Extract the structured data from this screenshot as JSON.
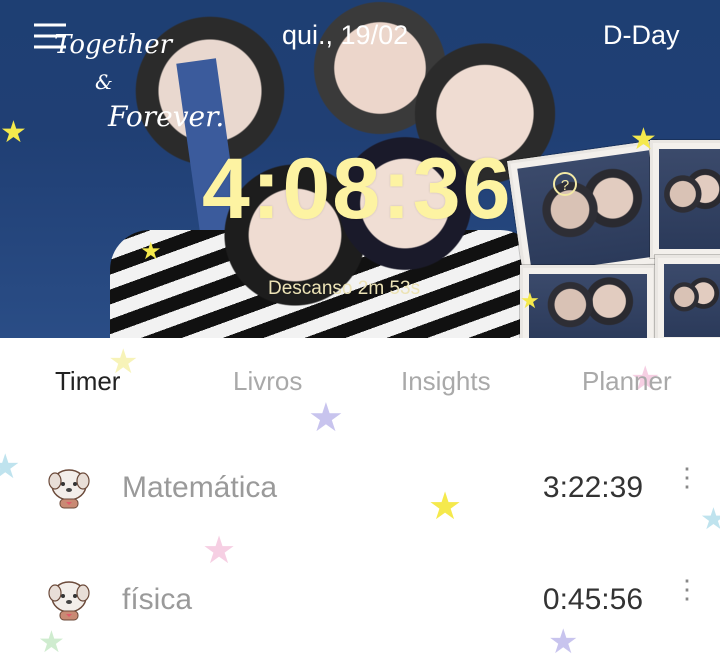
{
  "header": {
    "logo": {
      "line1": "Together",
      "amp": "&",
      "line2": "Forever."
    },
    "date": "qui., 19/02",
    "dday_label": "D-Day",
    "timer": "4:08:36",
    "rest_text": "Descanso 2m 53s"
  },
  "tabs": [
    {
      "label": "Timer",
      "active": true
    },
    {
      "label": "Livros",
      "active": false
    },
    {
      "label": "Insights",
      "active": false
    },
    {
      "label": "Planner",
      "active": false
    }
  ],
  "subjects": [
    {
      "name": "Matemática",
      "time": "3:22:39",
      "avatar_icon": "puppy-icon"
    },
    {
      "name": "física",
      "time": "0:45:56",
      "avatar_icon": "puppy-icon"
    }
  ],
  "colors": {
    "header_bg": "#203f74",
    "timer_text": "#fdf3a2",
    "tab_active": "#222222",
    "tab_inactive": "#a9a9a9",
    "star_yellow": "#f5e94c",
    "star_lavender": "#c8c4ee",
    "star_pink": "#f6cfe3"
  }
}
